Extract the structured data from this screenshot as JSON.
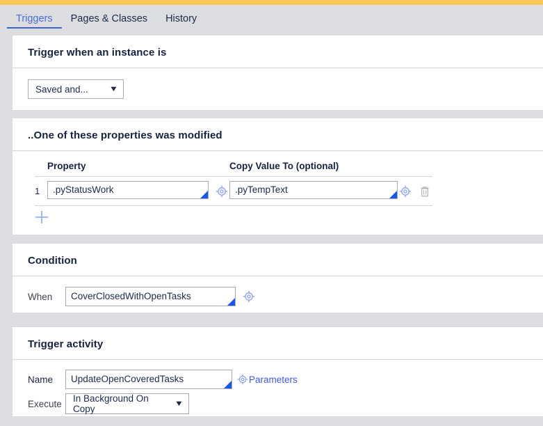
{
  "window": {
    "accent_color": "#fac85a",
    "background": "#dcdde1",
    "link_color": "#4357d6",
    "corner_marker_color": "#1a56e8"
  },
  "tabs": [
    {
      "label": "Triggers",
      "active": true
    },
    {
      "label": "Pages & Classes",
      "active": false
    },
    {
      "label": "History",
      "active": false
    }
  ],
  "sections": {
    "trigger_when": {
      "title": "Trigger when an instance is",
      "select": {
        "value": "Saved and...",
        "chevron": "chevron-down-icon"
      }
    },
    "properties_modified": {
      "title": "..One of these properties was modified",
      "columns": {
        "index": "",
        "property": "Property",
        "copy_value_to": "Copy Value To (optional)"
      },
      "rows": [
        {
          "index": "1",
          "property": ".pyStatusWork",
          "copy_value_to": ".pyTempText",
          "property_picker_icon": "crosshair-icon",
          "copy_picker_icon": "crosshair-icon",
          "delete_icon": "trash-icon"
        }
      ],
      "add_row": {
        "icon": "plus-icon",
        "label": ""
      }
    },
    "condition": {
      "title": "Condition",
      "when_label": "When",
      "when_value": "CoverClosedWithOpenTasks",
      "when_picker_icon": "crosshair-icon"
    },
    "trigger_activity": {
      "title": "Trigger activity",
      "name_label": "Name",
      "name_value": "UpdateOpenCoveredTasks",
      "parameters_icon": "crosshair-icon",
      "parameters_label": "Parameters",
      "execute_label": "Execute",
      "execute_value": "In Background On Copy",
      "execute_chevron": "chevron-down-icon"
    }
  }
}
